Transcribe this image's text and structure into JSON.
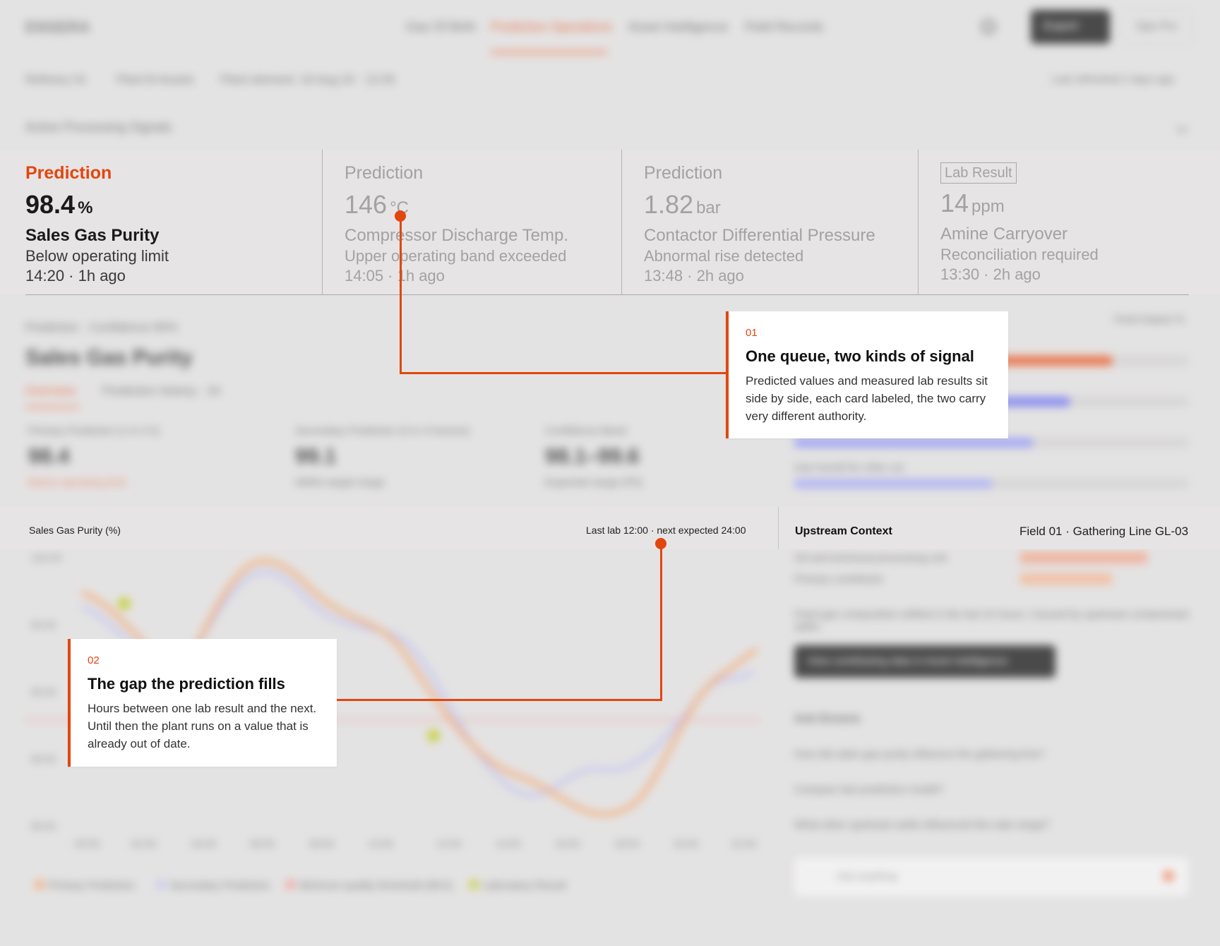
{
  "header": {
    "logo": "ENSERA",
    "nav": [
      "Gas Of Birth",
      "Predictive Operations",
      "Asset Intelligence",
      "Field Records"
    ],
    "cta": "Export",
    "user": "Ops Pro"
  },
  "breadcrumb": {
    "items": [
      "Refinery 01",
      "Plant B Assets",
      "Plant element: 16 Aug 24 · 13:35"
    ],
    "updated": "Last refreshed 2 days ago"
  },
  "queue_heading": "Active Processing Signals",
  "kpis": [
    {
      "label": "Prediction",
      "value": "98.4",
      "unit": "%",
      "name": "Sales Gas Purity",
      "status": "Below operating limit",
      "time": "14:20 · 1h ago"
    },
    {
      "label": "Prediction",
      "value": "146",
      "unit": "°C",
      "name": "Compressor Discharge Temp.",
      "status": "Upper operating band exceeded",
      "time": "14:05 · 1h ago"
    },
    {
      "label": "Prediction",
      "value": "1.82",
      "unit": "bar",
      "name": "Contactor Differential Pressure",
      "status": "Abnormal rise detected",
      "time": "13:48 · 2h ago"
    },
    {
      "label": "Lab Result",
      "value": "14",
      "unit": "ppm",
      "name": "Amine Carryover",
      "status": "Reconciliation required",
      "time": "13:30 · 2h ago"
    }
  ],
  "detail": {
    "breadcrumb": "Prediction · Confidence 95%",
    "title": "Sales Gas Purity",
    "tabs": [
      "Overview",
      "Prediction History · 24"
    ],
    "metrics": [
      {
        "label": "Primary Prediction (1 in 4 h)",
        "value": "98.4",
        "unit": "%",
        "note": "Below operating limit"
      },
      {
        "label": "Secondary Prediction (4 in 4 horizon)",
        "value": "99.1",
        "unit": "%",
        "note": "Within target range"
      },
      {
        "label": "Confidence Band",
        "value": "98.1–99.6",
        "unit": "%",
        "note": "Expected range (P5)"
      }
    ],
    "bars_title": "Feed impact %",
    "bars_label": "Gas humid for chlor cut"
  },
  "chart": {
    "title": "Sales Gas Purity (%)",
    "lab_note": "Last lab 12:00 · next expected 24:00",
    "legend": [
      "Primary Prediction",
      "Secondary Prediction",
      "Minimum quality threshold (98.5)",
      "Laboratory Result"
    ],
    "y_ticks": [
      "100.00",
      "99.50",
      "99.00",
      "98.50",
      "98.00"
    ],
    "x_ticks": [
      "00:00",
      "02:00",
      "04:00",
      "06:00",
      "08:00",
      "10:00",
      "12:00",
      "14:00",
      "16:00",
      "18:00",
      "20:00",
      "22:00"
    ]
  },
  "upstream": {
    "title": "Upstream Context",
    "source": "Field 01 · Gathering Line GL-03",
    "rows": [
      "Oil and technical processing unit",
      "Primary contributor"
    ],
    "desc": "Feed gas composition shifted in the last 24 hours. Caused by upstream contaminant spike.",
    "button": "View contributing data in Asset Intelligence",
    "questions_title": "Ask Ensera",
    "questions": [
      "How did sales gas purity influence the gathering line?",
      "Compare last prediction model?",
      "What other upstream wells influenced this ratio range?"
    ],
    "ask_placeholder": "Ask anything"
  },
  "callouts": [
    {
      "num": "01",
      "title": "One queue, two kinds of signal",
      "body": "Predicted values and measured lab results sit side by side, each card labeled, the two carry very different authority."
    },
    {
      "num": "02",
      "title": "The gap the prediction fills",
      "body": "Hours between one lab result and the next. Until then the plant runs on a value that is already out of date."
    }
  ],
  "colors": {
    "accent": "#e2460f",
    "primary_series": "#f3b07f",
    "secondary_series": "#c7c9f0",
    "lab": "#c9d24a"
  }
}
